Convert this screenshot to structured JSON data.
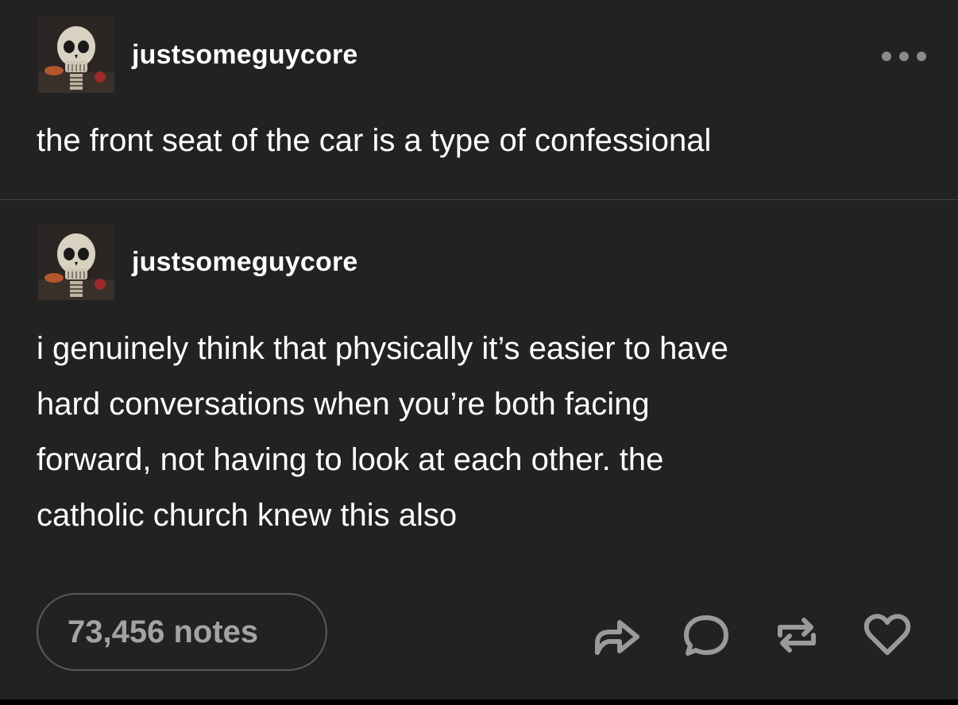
{
  "posts": [
    {
      "username": "justsomeguycore",
      "avatar": "skull-avatar",
      "lines": [
        "the front seat of the car is a type of confessional"
      ]
    },
    {
      "username": "justsomeguycore",
      "avatar": "skull-avatar",
      "lines": [
        "i genuinely think that physically it’s easier to have",
        "hard conversations when you’re both facing",
        "forward, not having to look at each other. the",
        "catholic church knew this also"
      ]
    }
  ],
  "footer": {
    "notes_label": "73,456 notes",
    "actions": [
      "share-icon",
      "reply-icon",
      "reblog-icon",
      "like-icon"
    ]
  },
  "header": {
    "menu_icon": "more-options-icon"
  },
  "colors": {
    "background": "#222222",
    "text": "#ffffff",
    "muted": "#a3a3a3",
    "divider": "#444444"
  }
}
